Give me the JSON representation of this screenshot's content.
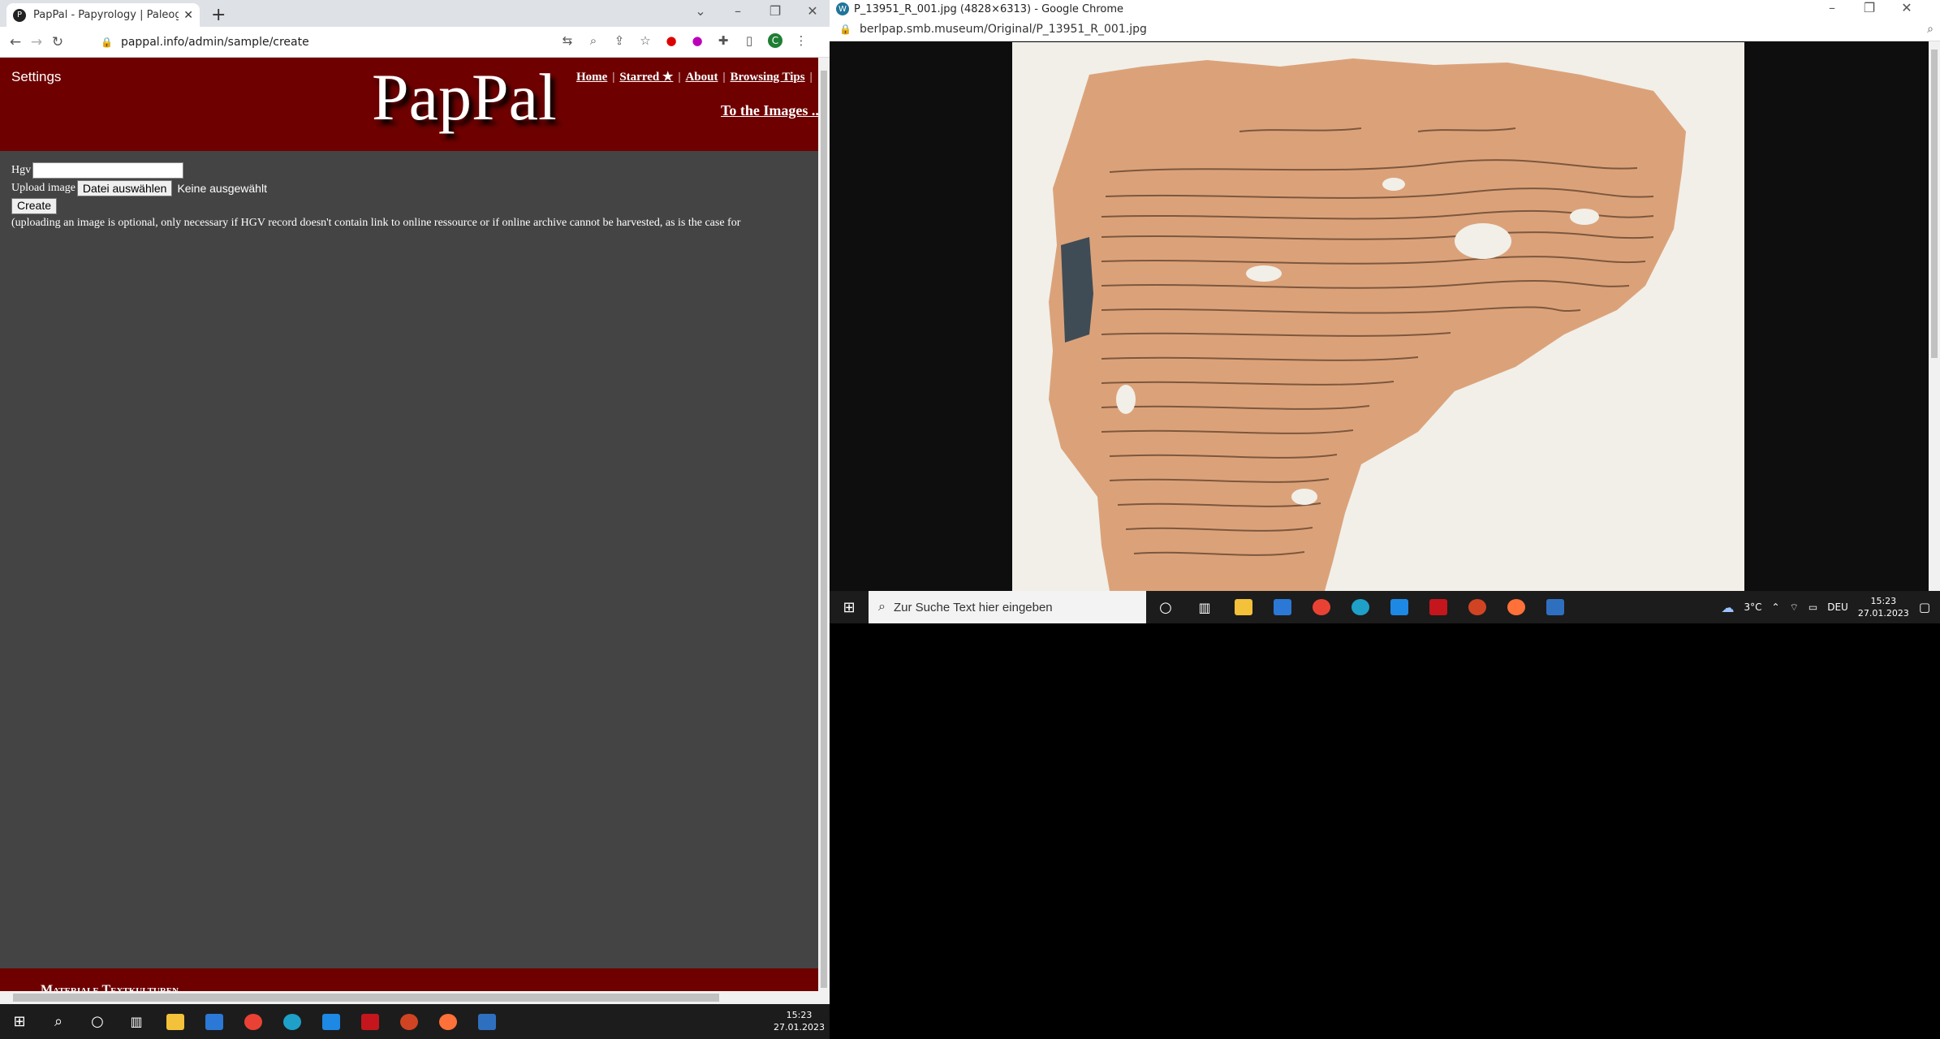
{
  "left_window": {
    "tab_title": "PapPal - Papyrology | Paleograph",
    "url": "pappal.info/admin/sample/create",
    "site": {
      "settings_label": "Settings",
      "logo": "PapPal",
      "nav": [
        "Home",
        "Starred ★",
        "About",
        "Browsing Tips"
      ],
      "to_images": "To the Images ..."
    },
    "form": {
      "hgv_label": "Hgv",
      "upload_label": "Upload image",
      "file_button": "Datei auswählen",
      "no_file": "Keine ausgewählt",
      "create_button": "Create",
      "note": "(uploading an image is optional, only necessary if HGV record doesn't contain link to online ressource or if online archive cannot be harvested, as is the case for"
    },
    "footer_text": "Materiale Textkulturen",
    "taskbar_time": "15:23",
    "taskbar_date": "27.01.2023"
  },
  "right_window": {
    "title": "P_13951_R_001.jpg (4828×6313) - Google Chrome",
    "url": "berlpap.smb.museum/Original/P_13951_R_001.jpg",
    "taskbar": {
      "search_placeholder": "Zur Suche Text hier eingeben",
      "weather": "3°C",
      "lang": "DEU",
      "time": "15:23",
      "date": "27.01.2023"
    }
  },
  "colors": {
    "header_red": "#6e0000",
    "page_bg": "#444444"
  }
}
